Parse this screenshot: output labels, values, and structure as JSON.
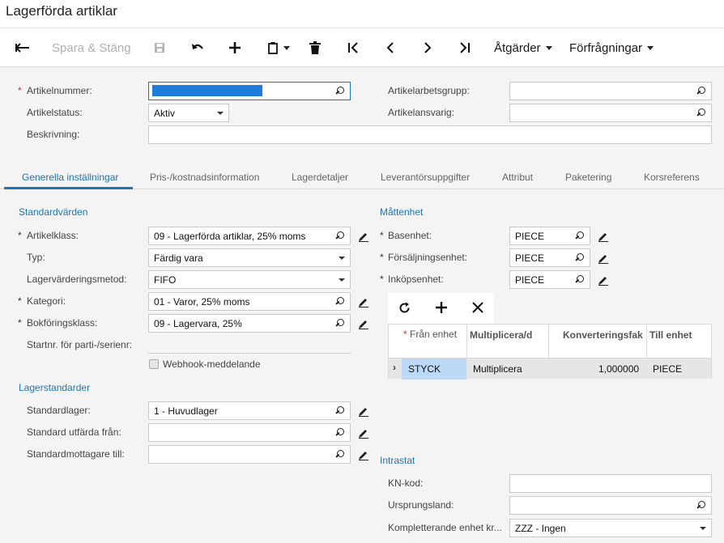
{
  "window": {
    "title": "Lagerförda artiklar"
  },
  "toolbar": {
    "save_close": "Spara & Stäng",
    "actions": "Åtgärder",
    "inquiries": "Förfrågningar"
  },
  "header_form": {
    "item_number_label": "Artikelnummer:",
    "item_number_value": "",
    "item_status_label": "Artikelstatus:",
    "item_status_value": "Aktiv",
    "description_label": "Beskrivning:",
    "description_value": "",
    "work_group_label": "Artikelarbetsgrupp:",
    "work_group_value": "",
    "manager_label": "Artikelansvarig:",
    "manager_value": ""
  },
  "tabs": [
    {
      "label": "Generella inställningar",
      "active": true
    },
    {
      "label": "Pris-/kostnadsinformation"
    },
    {
      "label": "Lagerdetaljer"
    },
    {
      "label": "Leverantörsuppgifter"
    },
    {
      "label": "Attribut"
    },
    {
      "label": "Paketering"
    },
    {
      "label": "Korsreferens"
    }
  ],
  "defaults": {
    "title": "Standardvärden",
    "item_class_label": "Artikelklass:",
    "item_class_value": "09 - Lagerförda artiklar, 25% moms",
    "type_label": "Typ:",
    "type_value": "Färdig vara",
    "valuation_label": "Lagervärderingsmetod:",
    "valuation_value": "FIFO",
    "category_label": "Kategori:",
    "category_value": "01 - Varor, 25% moms",
    "posting_class_label": "Bokföringsklass:",
    "posting_class_value": "09 - Lagervara, 25%",
    "lot_serial_label": "Startnr. för parti-/serienr:",
    "webhook_label": "Webhook-meddelande"
  },
  "warehouse": {
    "title": "Lagerstandarder",
    "default_wh_label": "Standardlager:",
    "default_wh_value": "1 - Huvudlager",
    "issue_from_label": "Standard utfärda från:",
    "issue_from_value": "",
    "receipt_to_label": "Standardmottagare till:",
    "receipt_to_value": ""
  },
  "uom": {
    "title": "Måttenhet",
    "base_label": "Basenhet:",
    "base_value": "PIECE",
    "sales_label": "Försäljningsenhet:",
    "sales_value": "PIECE",
    "purchase_label": "Inköpsenhet:",
    "purchase_value": "PIECE",
    "columns": [
      "Från enhet",
      "Multiplicera/d",
      "Konverteringsfak",
      "Till enhet"
    ],
    "rows": [
      {
        "from": "STYCK",
        "multiply": "Multiplicera",
        "factor": "1,000000",
        "to": "PIECE"
      }
    ]
  },
  "intrastat": {
    "title": "Intrastat",
    "kn_label": "KN-kod:",
    "kn_value": "",
    "origin_label": "Ursprungsland:",
    "origin_value": "",
    "supp_unit_label": "Kompletterande enhet kr...",
    "supp_unit_value": "ZZZ - Ingen"
  },
  "colors": {
    "accent": "#1f73b7",
    "required": "#d0342c",
    "selected_cell": "#bcdaf5"
  }
}
